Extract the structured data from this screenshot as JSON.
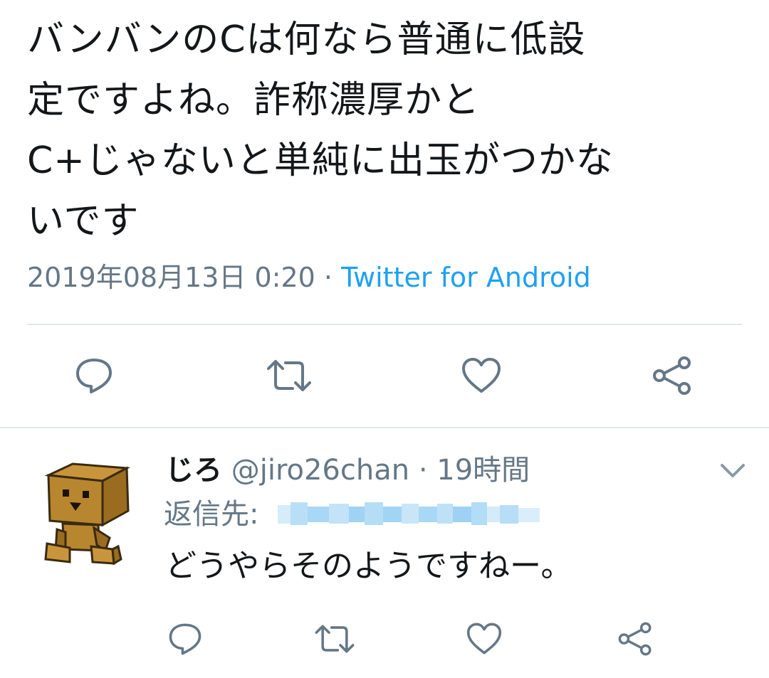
{
  "main_tweet": {
    "text": "バンバンのCは何なら普通に低設\n定ですよね。詐称濃厚かと\nC+じゃないと単純に出玉がつかな\nいです",
    "timestamp": "2019年08月13日 0:20",
    "separator": "·",
    "source": "Twitter for Android"
  },
  "main_actions": [
    {
      "icon": "reply-icon"
    },
    {
      "icon": "retweet-icon"
    },
    {
      "icon": "like-icon"
    },
    {
      "icon": "share-icon"
    }
  ],
  "reply": {
    "display_name": "じろ",
    "handle": "@jiro26chan",
    "separator": "·",
    "time": "19時間",
    "reply_to_label": "返信先:",
    "text": "どうやらそのようですねー。"
  },
  "reply_actions": [
    {
      "icon": "reply-icon"
    },
    {
      "icon": "retweet-icon"
    },
    {
      "icon": "like-icon"
    },
    {
      "icon": "share-icon"
    }
  ],
  "colors": {
    "text_primary": "#14171a",
    "text_secondary": "#657786",
    "link": "#1da1f2",
    "icon": "#657786",
    "divider": "#e1e8ed",
    "blur": "#a8d8f5"
  }
}
